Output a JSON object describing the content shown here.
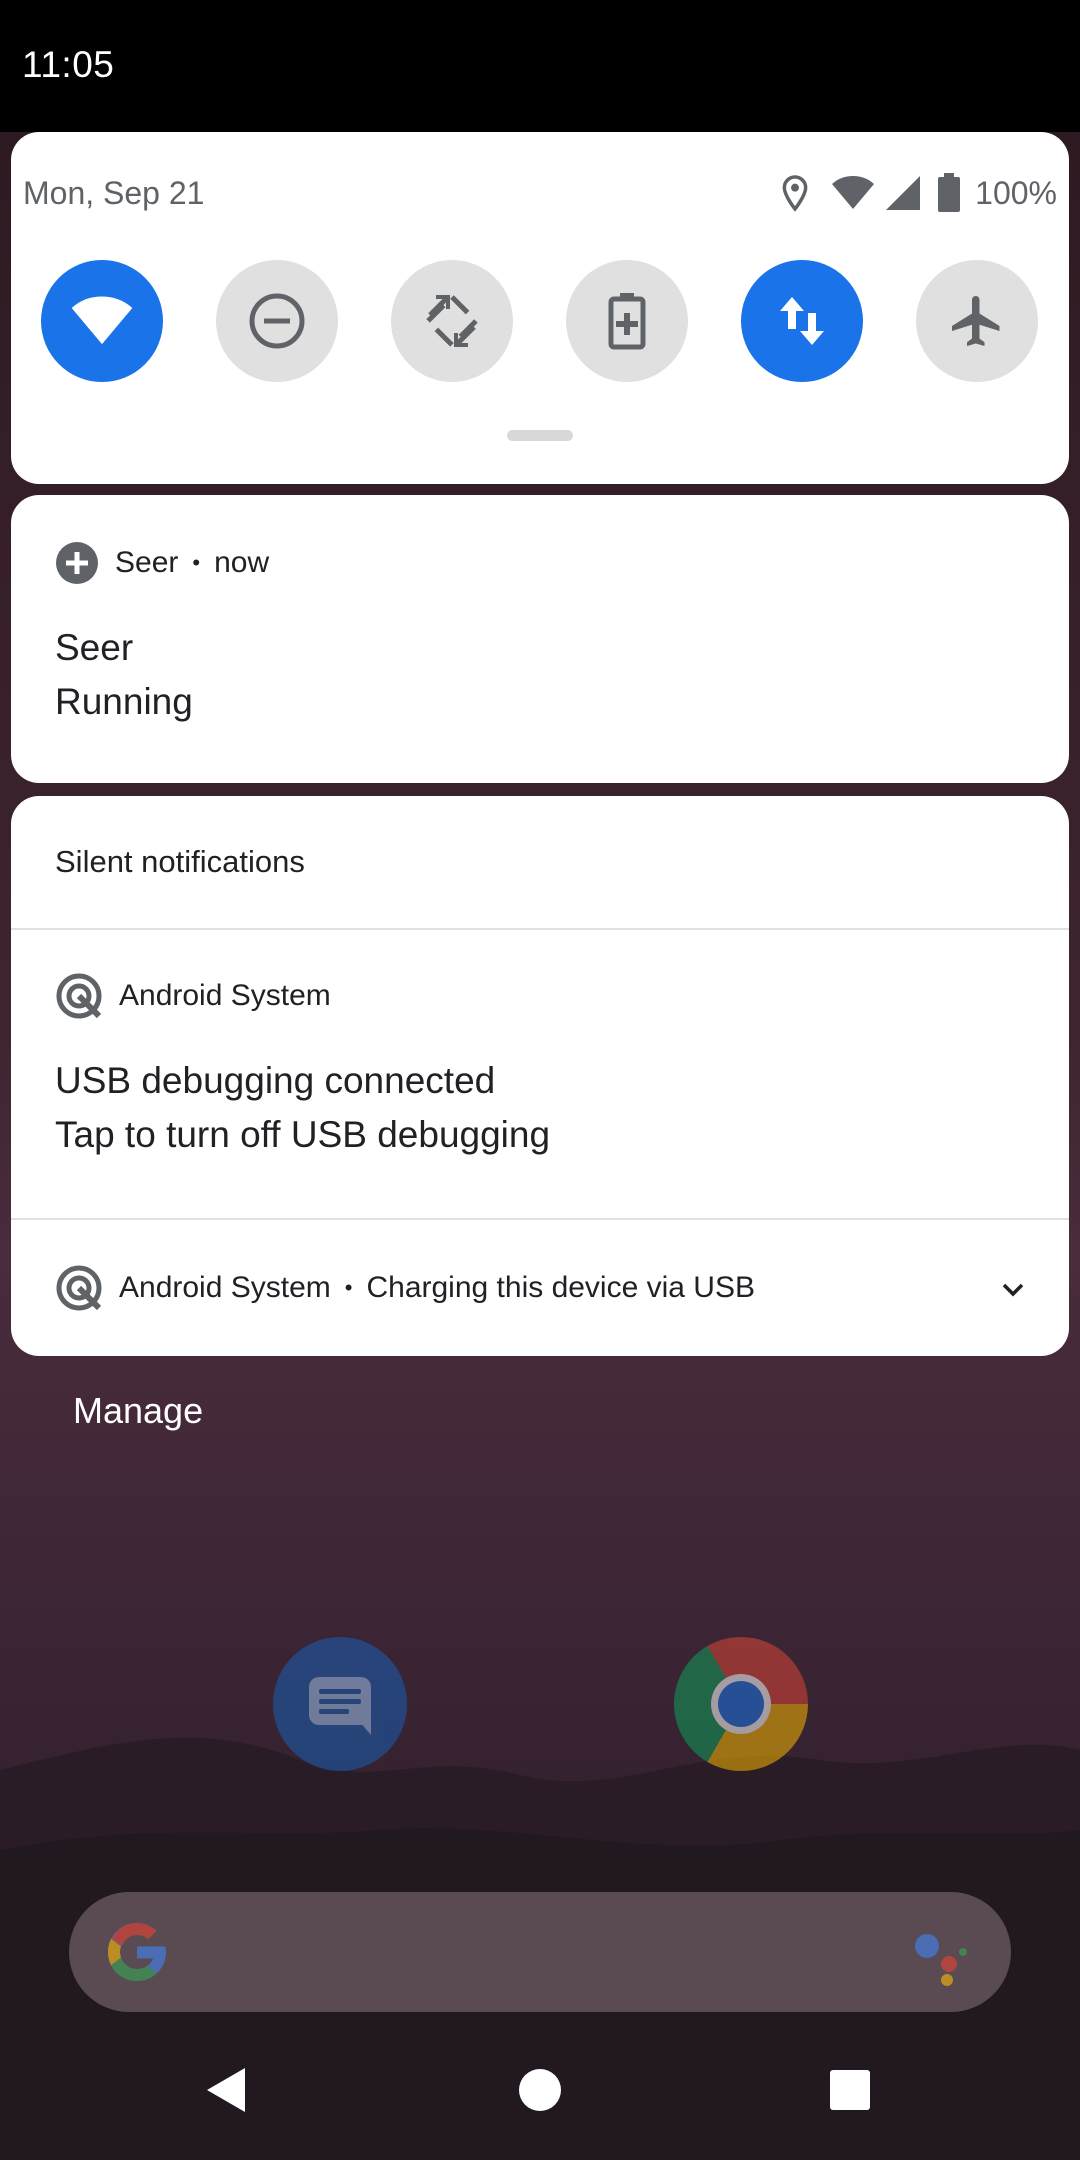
{
  "status_bar": {
    "time": "11:05"
  },
  "quick_settings": {
    "date": "Mon, Sep 21",
    "battery_percent": "100%",
    "tiles": [
      {
        "name": "wifi",
        "on": true
      },
      {
        "name": "do-not-disturb",
        "on": false
      },
      {
        "name": "auto-rotate",
        "on": false
      },
      {
        "name": "battery-saver",
        "on": false
      },
      {
        "name": "mobile-data",
        "on": true
      },
      {
        "name": "airplane-mode",
        "on": false
      }
    ]
  },
  "notifications": {
    "seer": {
      "app_name": "Seer",
      "time": "now",
      "title": "Seer",
      "text": "Running"
    },
    "silent_header": "Silent notifications",
    "usb_debugging": {
      "app_name": "Android System",
      "title": "USB debugging connected",
      "text": "Tap to turn off USB debugging"
    },
    "usb_charging": {
      "app_name": "Android System",
      "summary": "Charging this device via USB"
    }
  },
  "manage_label": "Manage",
  "colors": {
    "accent": "#1a73e8",
    "tile_off": "#e0e0e0",
    "icon_gray": "#5f6368"
  }
}
